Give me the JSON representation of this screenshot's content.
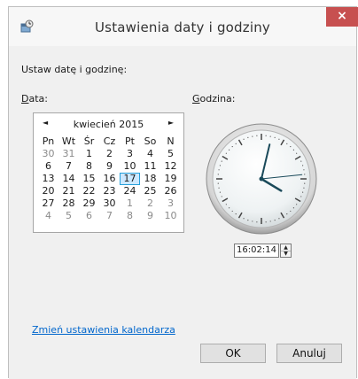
{
  "window": {
    "title": "Ustawienia daty i godziny",
    "close_glyph": "×"
  },
  "instructions": "Ustaw datę i godzinę:",
  "date_label": {
    "accel": "D",
    "rest": "ata:"
  },
  "time_label": {
    "accel": "G",
    "rest": "odzina:"
  },
  "calendar": {
    "month": "kwiecień 2015",
    "prev_glyph": "◄",
    "next_glyph": "►",
    "weekdays": [
      "Pn",
      "Wt",
      "Śr",
      "Cz",
      "Pt",
      "So",
      "N"
    ],
    "weeks": [
      [
        "30",
        "31",
        "1",
        "2",
        "3",
        "4",
        "5"
      ],
      [
        "6",
        "7",
        "8",
        "9",
        "10",
        "11",
        "12"
      ],
      [
        "13",
        "14",
        "15",
        "16",
        "17",
        "18",
        "19"
      ],
      [
        "20",
        "21",
        "22",
        "23",
        "24",
        "25",
        "26"
      ],
      [
        "27",
        "28",
        "29",
        "30",
        "1",
        "2",
        "3"
      ],
      [
        "4",
        "5",
        "6",
        "7",
        "8",
        "9",
        "10"
      ]
    ],
    "selected_day": "17"
  },
  "clock": {
    "hours": 16,
    "minutes": 2,
    "seconds": 14
  },
  "time_value": "16:02:14",
  "link": "Zmień ustawienia kalendarza",
  "buttons": {
    "ok": "OK",
    "cancel": "Anuluj"
  },
  "colors": {
    "close": "#c75050",
    "link": "#0066cc",
    "selection": "#cce8ff",
    "clock_hands": "#1a4a5a"
  }
}
